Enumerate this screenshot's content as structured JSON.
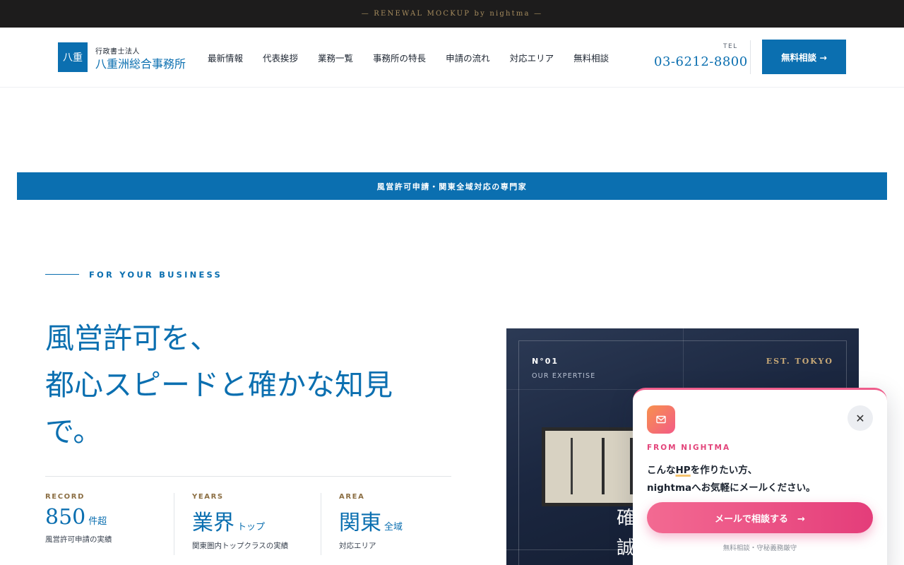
{
  "topbar": {
    "text": "— RENEWAL MOCKUP  by nightma —"
  },
  "header": {
    "logo_mark": "八重",
    "logo_sub": "行政書士法人",
    "logo_name": "八重洲総合事務所",
    "nav": [
      "最新情報",
      "代表挨拶",
      "業務一覧",
      "事務所の特長",
      "申請の流れ",
      "対応エリア",
      "無料相談"
    ],
    "tel_label": "TEL",
    "tel_number": "03-6212-8800",
    "cta_label": "無料相談 →"
  },
  "banner": {
    "text": "風営許可申請・関東全域対応の専門家"
  },
  "hero": {
    "eyebrow": "FOR YOUR BUSINESS",
    "headline_lines": [
      "風営許可を、",
      "都心スピードと確かな知見",
      "で。"
    ]
  },
  "stats": [
    {
      "label": "RECORD",
      "value": "850",
      "unit": "件超",
      "desc": "風営許可申請の実績"
    },
    {
      "label": "YEARS",
      "value": "業界",
      "unit": "トップ",
      "desc": "関東圏内トップクラスの実績"
    },
    {
      "label": "AREA",
      "value": "関東",
      "unit": "全域",
      "desc": "対応エリア"
    }
  ],
  "photo": {
    "number": "N°01",
    "caption": "OUR EXPERTISE",
    "est": "EST. TOKYO",
    "overlay_line1": "確",
    "overlay_line2": "誠"
  },
  "popup": {
    "from": "FROM NIGHTMA",
    "message_pre": "こんな",
    "message_hp": "HP",
    "message_post": "を作りたい方、",
    "message_line2": "nightmaへお気軽にメールください。",
    "button_label": "メールで相談する　→",
    "note": "無料相談・守秘義務厳守",
    "close_icon": "close-icon",
    "mail_icon": "mail-icon",
    "accent_color": "#e43d7a"
  },
  "colors": {
    "brand": "#0b6fb0",
    "gold": "#8c6f44",
    "topbar_bg": "#1d1c1c"
  }
}
